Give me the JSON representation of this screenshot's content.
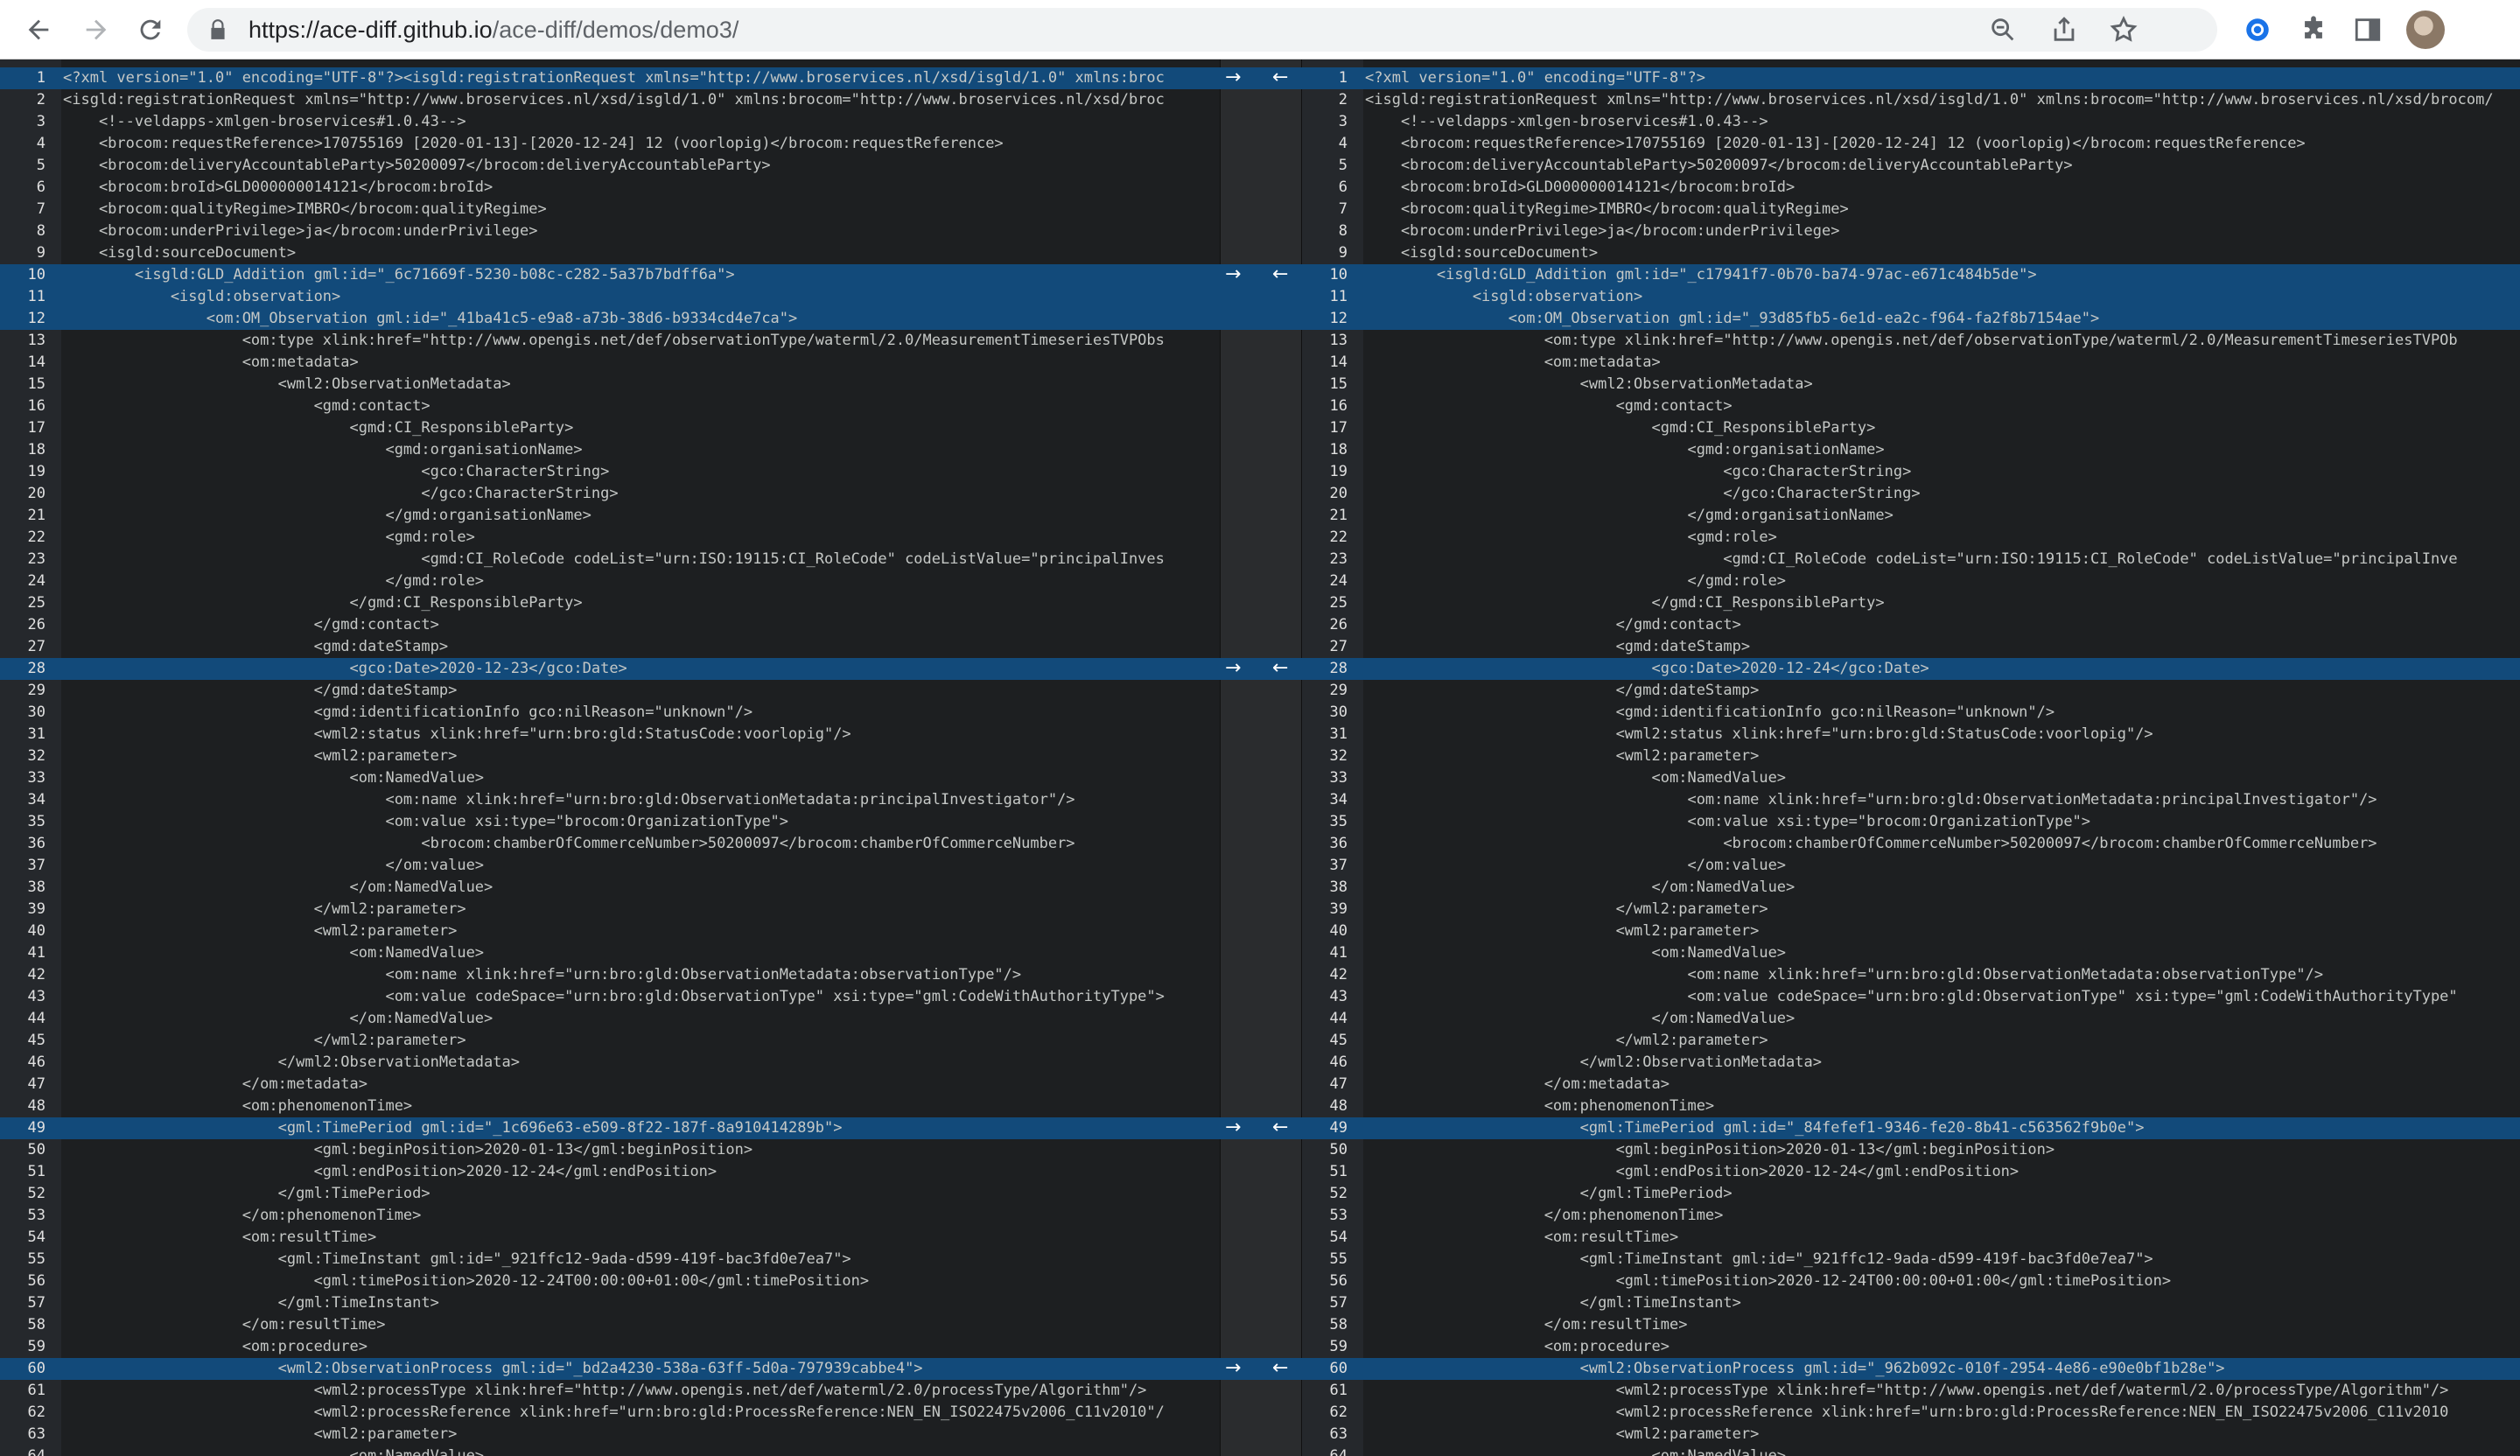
{
  "browser": {
    "url_host": "https://ace-diff.github.io",
    "url_path": "/ace-diff/demos/demo3/",
    "icons": [
      "back-icon",
      "forward-icon",
      "reload-icon",
      "lock-icon",
      "zoom-icon",
      "share-icon",
      "bookmark-star-icon",
      "extension-circle-icon",
      "puzzle-icon",
      "side-panel-icon",
      "profile-avatar"
    ]
  },
  "colors": {
    "editor_bg": "#1d1f21",
    "diff_highlight": "#124a7a",
    "text": "#c5c8c6"
  },
  "diff_blocks": [
    {
      "left_lines": [
        1,
        1
      ],
      "right_lines": [
        1,
        1
      ]
    },
    {
      "left_lines": [
        10,
        12
      ],
      "right_lines": [
        10,
        12
      ]
    },
    {
      "left_lines": [
        28,
        28
      ],
      "right_lines": [
        28,
        28
      ]
    },
    {
      "left_lines": [
        49,
        49
      ],
      "right_lines": [
        49,
        49
      ]
    },
    {
      "left_lines": [
        60,
        60
      ],
      "right_lines": [
        60,
        60
      ]
    }
  ],
  "connector": {
    "copy_right_glyph": "→",
    "copy_left_glyph": "←"
  },
  "left_lines": [
    "<?xml version=\"1.0\" encoding=\"UTF-8\"?><isgld:registrationRequest xmlns=\"http://www.broservices.nl/xsd/isgld/1.0\" xmlns:broc",
    "<isgld:registrationRequest xmlns=\"http://www.broservices.nl/xsd/isgld/1.0\" xmlns:brocom=\"http://www.broservices.nl/xsd/broc",
    "    <!--veldapps-xmlgen-broservices#1.0.43-->",
    "    <brocom:requestReference>170755169 [2020-01-13]-[2020-12-24] 12 (voorlopig)</brocom:requestReference>",
    "    <brocom:deliveryAccountableParty>50200097</brocom:deliveryAccountableParty>",
    "    <brocom:broId>GLD000000014121</brocom:broId>",
    "    <brocom:qualityRegime>IMBRO</brocom:qualityRegime>",
    "    <brocom:underPrivilege>ja</brocom:underPrivilege>",
    "    <isgld:sourceDocument>",
    "        <isgld:GLD_Addition gml:id=\"_6c71669f-5230-b08c-c282-5a37b7bdff6a\">",
    "            <isgld:observation>",
    "                <om:OM_Observation gml:id=\"_41ba41c5-e9a8-a73b-38d6-b9334cd4e7ca\">",
    "                    <om:type xlink:href=\"http://www.opengis.net/def/observationType/waterml/2.0/MeasurementTimeseriesTVPObs",
    "                    <om:metadata>",
    "                        <wml2:ObservationMetadata>",
    "                            <gmd:contact>",
    "                                <gmd:CI_ResponsibleParty>",
    "                                    <gmd:organisationName>",
    "                                        <gco:CharacterString>",
    "                                        </gco:CharacterString>",
    "                                    </gmd:organisationName>",
    "                                    <gmd:role>",
    "                                        <gmd:CI_RoleCode codeList=\"urn:ISO:19115:CI_RoleCode\" codeListValue=\"principalInves",
    "                                    </gmd:role>",
    "                                </gmd:CI_ResponsibleParty>",
    "                            </gmd:contact>",
    "                            <gmd:dateStamp>",
    "                                <gco:Date>2020-12-23</gco:Date>",
    "                            </gmd:dateStamp>",
    "                            <gmd:identificationInfo gco:nilReason=\"unknown\"/>",
    "                            <wml2:status xlink:href=\"urn:bro:gld:StatusCode:voorlopig\"/>",
    "                            <wml2:parameter>",
    "                                <om:NamedValue>",
    "                                    <om:name xlink:href=\"urn:bro:gld:ObservationMetadata:principalInvestigator\"/>",
    "                                    <om:value xsi:type=\"brocom:OrganizationType\">",
    "                                        <brocom:chamberOfCommerceNumber>50200097</brocom:chamberOfCommerceNumber>",
    "                                    </om:value>",
    "                                </om:NamedValue>",
    "                            </wml2:parameter>",
    "                            <wml2:parameter>",
    "                                <om:NamedValue>",
    "                                    <om:name xlink:href=\"urn:bro:gld:ObservationMetadata:observationType\"/>",
    "                                    <om:value codeSpace=\"urn:bro:gld:ObservationType\" xsi:type=\"gml:CodeWithAuthorityType\">",
    "                                </om:NamedValue>",
    "                            </wml2:parameter>",
    "                        </wml2:ObservationMetadata>",
    "                    </om:metadata>",
    "                    <om:phenomenonTime>",
    "                        <gml:TimePeriod gml:id=\"_1c696e63-e509-8f22-187f-8a910414289b\">",
    "                            <gml:beginPosition>2020-01-13</gml:beginPosition>",
    "                            <gml:endPosition>2020-12-24</gml:endPosition>",
    "                        </gml:TimePeriod>",
    "                    </om:phenomenonTime>",
    "                    <om:resultTime>",
    "                        <gml:TimeInstant gml:id=\"_921ffc12-9ada-d599-419f-bac3fd0e7ea7\">",
    "                            <gml:timePosition>2020-12-24T00:00:00+01:00</gml:timePosition>",
    "                        </gml:TimeInstant>",
    "                    </om:resultTime>",
    "                    <om:procedure>",
    "                        <wml2:ObservationProcess gml:id=\"_bd2a4230-538a-63ff-5d0a-797939cabbe4\">",
    "                            <wml2:processType xlink:href=\"http://www.opengis.net/def/waterml/2.0/processType/Algorithm\"/>",
    "                            <wml2:processReference xlink:href=\"urn:bro:gld:ProcessReference:NEN_EN_ISO22475v2006_C11v2010\"/",
    "                            <wml2:parameter>",
    "                                <om:NamedValue>"
  ],
  "right_lines": [
    "<?xml version=\"1.0\" encoding=\"UTF-8\"?>",
    "<isgld:registrationRequest xmlns=\"http://www.broservices.nl/xsd/isgld/1.0\" xmlns:brocom=\"http://www.broservices.nl/xsd/brocom/",
    "    <!--veldapps-xmlgen-broservices#1.0.43-->",
    "    <brocom:requestReference>170755169 [2020-01-13]-[2020-12-24] 12 (voorlopig)</brocom:requestReference>",
    "    <brocom:deliveryAccountableParty>50200097</brocom:deliveryAccountableParty>",
    "    <brocom:broId>GLD000000014121</brocom:broId>",
    "    <brocom:qualityRegime>IMBRO</brocom:qualityRegime>",
    "    <brocom:underPrivilege>ja</brocom:underPrivilege>",
    "    <isgld:sourceDocument>",
    "        <isgld:GLD_Addition gml:id=\"_c17941f7-0b70-ba74-97ac-e671c484b5de\">",
    "            <isgld:observation>",
    "                <om:OM_Observation gml:id=\"_93d85fb5-6e1d-ea2c-f964-fa2f8b7154ae\">",
    "                    <om:type xlink:href=\"http://www.opengis.net/def/observationType/waterml/2.0/MeasurementTimeseriesTVPOb",
    "                    <om:metadata>",
    "                        <wml2:ObservationMetadata>",
    "                            <gmd:contact>",
    "                                <gmd:CI_ResponsibleParty>",
    "                                    <gmd:organisationName>",
    "                                        <gco:CharacterString>",
    "                                        </gco:CharacterString>",
    "                                    </gmd:organisationName>",
    "                                    <gmd:role>",
    "                                        <gmd:CI_RoleCode codeList=\"urn:ISO:19115:CI_RoleCode\" codeListValue=\"principalInve",
    "                                    </gmd:role>",
    "                                </gmd:CI_ResponsibleParty>",
    "                            </gmd:contact>",
    "                            <gmd:dateStamp>",
    "                                <gco:Date>2020-12-24</gco:Date>",
    "                            </gmd:dateStamp>",
    "                            <gmd:identificationInfo gco:nilReason=\"unknown\"/>",
    "                            <wml2:status xlink:href=\"urn:bro:gld:StatusCode:voorlopig\"/>",
    "                            <wml2:parameter>",
    "                                <om:NamedValue>",
    "                                    <om:name xlink:href=\"urn:bro:gld:ObservationMetadata:principalInvestigator\"/>",
    "                                    <om:value xsi:type=\"brocom:OrganizationType\">",
    "                                        <brocom:chamberOfCommerceNumber>50200097</brocom:chamberOfCommerceNumber>",
    "                                    </om:value>",
    "                                </om:NamedValue>",
    "                            </wml2:parameter>",
    "                            <wml2:parameter>",
    "                                <om:NamedValue>",
    "                                    <om:name xlink:href=\"urn:bro:gld:ObservationMetadata:observationType\"/>",
    "                                    <om:value codeSpace=\"urn:bro:gld:ObservationType\" xsi:type=\"gml:CodeWithAuthorityType\"",
    "                                </om:NamedValue>",
    "                            </wml2:parameter>",
    "                        </wml2:ObservationMetadata>",
    "                    </om:metadata>",
    "                    <om:phenomenonTime>",
    "                        <gml:TimePeriod gml:id=\"_84fefef1-9346-fe20-8b41-c563562f9b0e\">",
    "                            <gml:beginPosition>2020-01-13</gml:beginPosition>",
    "                            <gml:endPosition>2020-12-24</gml:endPosition>",
    "                        </gml:TimePeriod>",
    "                    </om:phenomenonTime>",
    "                    <om:resultTime>",
    "                        <gml:TimeInstant gml:id=\"_921ffc12-9ada-d599-419f-bac3fd0e7ea7\">",
    "                            <gml:timePosition>2020-12-24T00:00:00+01:00</gml:timePosition>",
    "                        </gml:TimeInstant>",
    "                    </om:resultTime>",
    "                    <om:procedure>",
    "                        <wml2:ObservationProcess gml:id=\"_962b092c-010f-2954-4e86-e90e0bf1b28e\">",
    "                            <wml2:processType xlink:href=\"http://www.opengis.net/def/waterml/2.0/processType/Algorithm\"/>",
    "                            <wml2:processReference xlink:href=\"urn:bro:gld:ProcessReference:NEN_EN_ISO22475v2006_C11v2010",
    "                            <wml2:parameter>",
    "                                <om:NamedValue>"
  ]
}
